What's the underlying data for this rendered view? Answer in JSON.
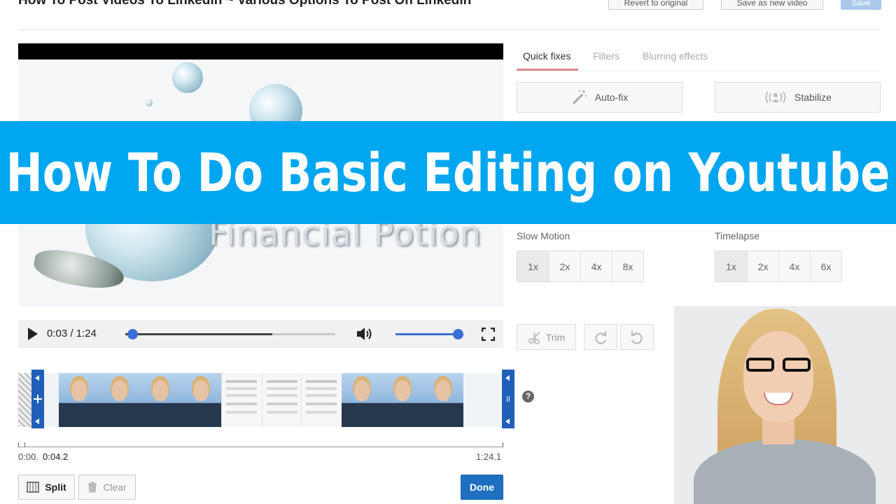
{
  "header": {
    "title": "How To Post Videos To Linkedin ~ Various Options To Post On Linkedin",
    "revert_label": "Revert to original",
    "save_new_label": "Save as new video",
    "save_label": "Save"
  },
  "player": {
    "time": "0:03 / 1:24",
    "progress": 0.7,
    "scrub_position": 0.036,
    "volume": 1.0
  },
  "timeline": {
    "start_label": "0:00.",
    "current_label": "0:04.2",
    "end_label": "1:24.1"
  },
  "actions": {
    "split_label": "Split",
    "clear_label": "Clear",
    "done_label": "Done"
  },
  "tabs": [
    {
      "label": "Quick fixes"
    },
    {
      "label": "Filters"
    },
    {
      "label": "Blurring effects"
    }
  ],
  "quick_fixes": {
    "autofix_label": "Auto-fix",
    "stabilize_label": "Stabilize"
  },
  "slow_motion": {
    "label": "Slow Motion",
    "options": [
      "1x",
      "2x",
      "4x",
      "8x"
    ]
  },
  "timelapse": {
    "label": "Timelapse",
    "options": [
      "1x",
      "2x",
      "4x",
      "6x"
    ]
  },
  "tools": {
    "trim_label": "Trim"
  },
  "video_preview": {
    "logo_text": "Financial Potion"
  },
  "banner": {
    "text": "How To Do Basic Editing on Youtube"
  },
  "colors": {
    "banner": "#00a6ef",
    "accent": "#3b6fd6",
    "done": "#1f6fc1"
  }
}
